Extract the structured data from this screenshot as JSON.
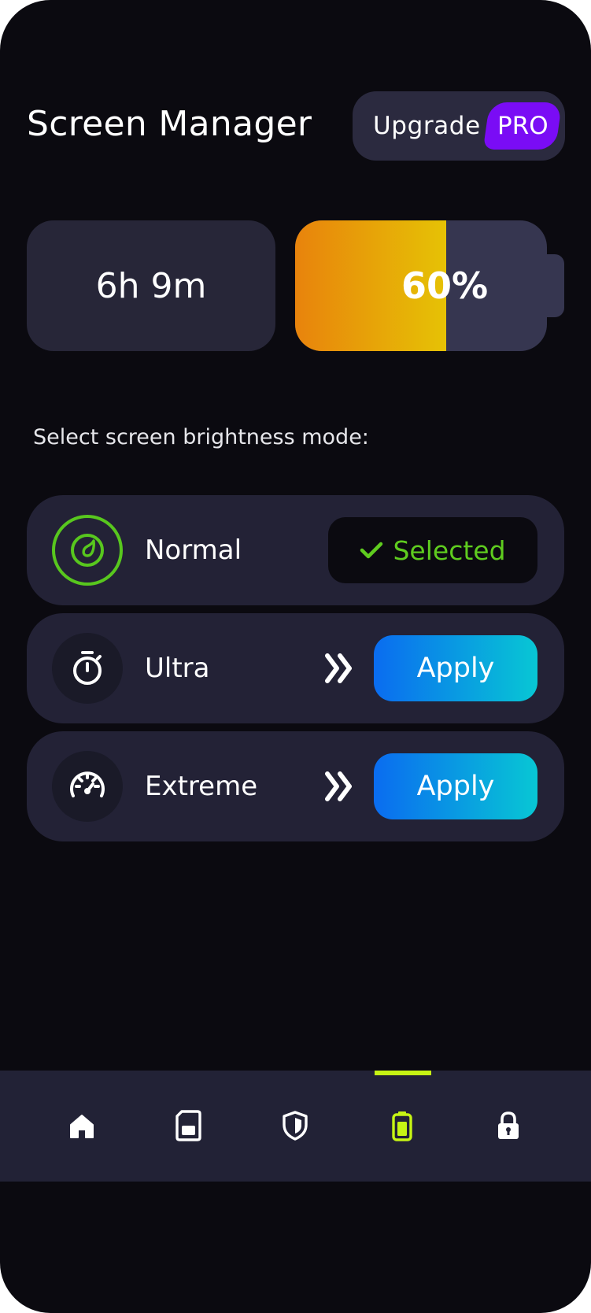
{
  "header": {
    "title": "Screen Manager",
    "upgrade_label": "Upgrade",
    "pro_badge": "PRO"
  },
  "stats": {
    "time_remaining": "6h 9m",
    "battery_percent_label": "60%",
    "battery_level": 0.6
  },
  "section": {
    "label": "Select screen brightness mode:"
  },
  "modes": [
    {
      "name": "Normal",
      "icon": "gauge-leaf-icon",
      "status": "Selected",
      "status_icon": "check-icon"
    },
    {
      "name": "Ultra",
      "icon": "stopwatch-icon",
      "action": "Apply",
      "arrow_icon": "double-chevron-right-icon"
    },
    {
      "name": "Extreme",
      "icon": "speedometer-icon",
      "action": "Apply",
      "arrow_icon": "double-chevron-right-icon"
    }
  ],
  "nav": {
    "items": [
      {
        "icon": "home-icon"
      },
      {
        "icon": "sim-card-icon"
      },
      {
        "icon": "shield-icon"
      },
      {
        "icon": "battery-icon",
        "active": true
      },
      {
        "icon": "lock-icon"
      }
    ]
  },
  "colors": {
    "background": "#0b0a10",
    "card": "#232236",
    "accent_green": "#5fcc1f",
    "accent_lime": "#c6f414",
    "pro_purple": "#7a0cf5",
    "battery_fill_start": "#e8830c",
    "battery_fill_end": "#e6c205",
    "apply_start": "#0a6cf0",
    "apply_end": "#08c7d4"
  }
}
